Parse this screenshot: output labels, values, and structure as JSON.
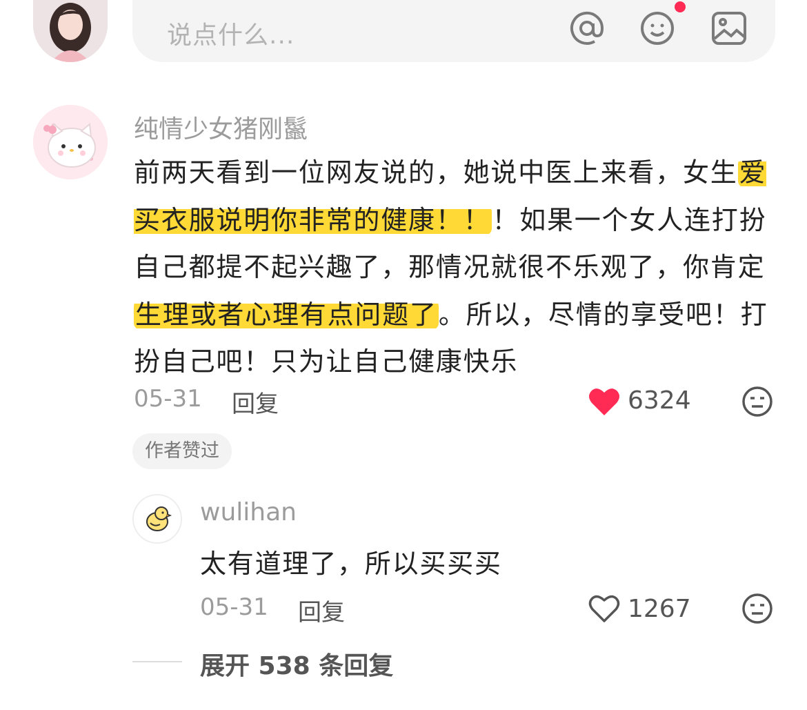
{
  "composer": {
    "placeholder": "说点什么...",
    "icons": [
      "mention-icon",
      "emoji-icon",
      "image-icon"
    ]
  },
  "comment": {
    "username": "纯情少女猪刚鬣",
    "text_parts": [
      "前两天看到一位网友说的，她说中医上来看，女生",
      "爱买衣服说明你非常的健康！！",
      "！如果一个女人连打扮自己都提不起兴趣了，那情况就很不乐观了，你肯定",
      "生理或者心理有点问题了",
      "。所以，尽情的享受吧！打扮自己吧！只为让自己健康快乐"
    ],
    "date": "05-31",
    "reply_label": "回复",
    "likes": "6324",
    "liked": true,
    "badge": "作者赞过"
  },
  "reply": {
    "username": "wulihan",
    "text": "太有道理了，所以买买买",
    "date": "05-31",
    "reply_label": "回复",
    "likes": "1267",
    "liked": false
  },
  "expand": {
    "label": "展开 538 条回复"
  },
  "colors": {
    "highlight": "#ffd935",
    "like_red": "#ff2b55",
    "secondary_text": "#9b9b9b"
  }
}
